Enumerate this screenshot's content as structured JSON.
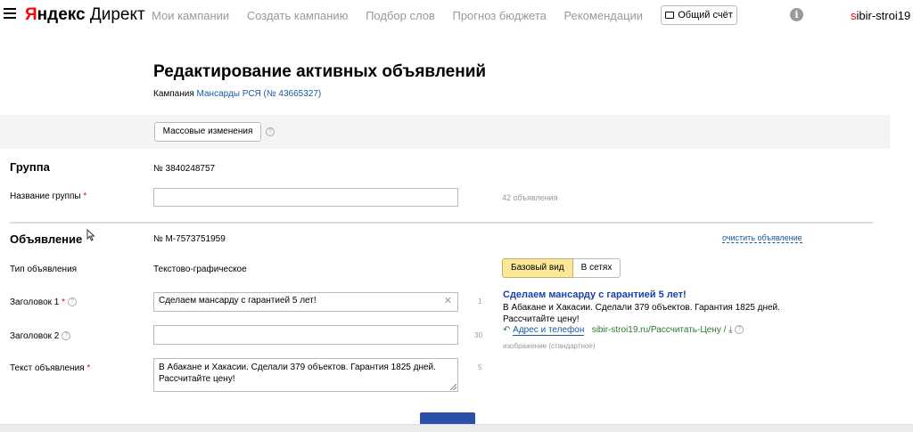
{
  "header": {
    "logo_ya_first": "Я",
    "logo_ya_rest": "ндекс",
    "logo_direct": "Директ",
    "nav": [
      "Мои кампании",
      "Создать кампанию",
      "Подбор слов",
      "Прогноз бюджета",
      "Рекомендации"
    ],
    "account_button": "Общий счёт",
    "info_icon_glyph": "i",
    "user_first": "s",
    "user_rest": "ibir-stroi19"
  },
  "page": {
    "title": "Редактирование активных объявлений",
    "campaign_label": "Кампания",
    "campaign_link": "Мансарды РСЯ (№ 43665327)"
  },
  "toolbar": {
    "mass_button": "Массовые изменения",
    "help_glyph": "?"
  },
  "group": {
    "section_title": "Группа",
    "number": "№ 3840248757",
    "name_label": "Название группы",
    "required_mark": "*",
    "name_value": "",
    "ads_count": "42 объявления"
  },
  "ad": {
    "section_title": "Объявление",
    "number": "№ М-7573751959",
    "clear_link": "очистить объявление",
    "type_label": "Тип объявления",
    "type_value": "Текстово-графическое",
    "title1_label": "Заголовок 1",
    "title1_value": "Сделаем мансарду с гарантией 5 лет!",
    "title1_counter": "1",
    "clear_glyph": "✕",
    "title2_label": "Заголовок 2",
    "title2_value": "",
    "title2_counter": "30",
    "text_label": "Текст объявления",
    "text_value": "В Абакане и Хакасии. Сделали 379 объектов. Гарантия 1825 дней. Рассчитайте цену!",
    "text_counter": "5"
  },
  "preview": {
    "tab_basic": "Базовый вид",
    "tab_networks": "В сетях",
    "ad_title": "Сделаем мансарду с гарантией 5 лет!",
    "ad_text": "В Абакане и Хакасии. Сделали 379 объектов. Гарантия 1825 дней. Рассчитайте цену!",
    "address_link": "Адрес и телефон",
    "site_url": "sibir-stroi19.ru/Рассчитать-Цену / ",
    "image_note": "изображение (стандартное)"
  }
}
